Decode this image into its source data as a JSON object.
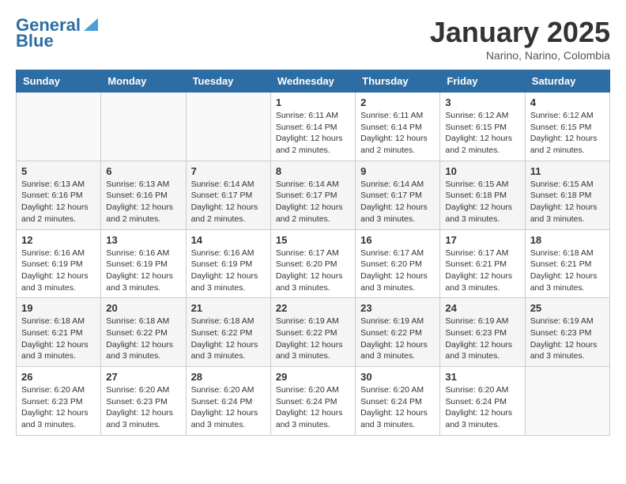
{
  "logo": {
    "line1": "General",
    "line2": "Blue"
  },
  "title": "January 2025",
  "subtitle": "Narino, Narino, Colombia",
  "headers": [
    "Sunday",
    "Monday",
    "Tuesday",
    "Wednesday",
    "Thursday",
    "Friday",
    "Saturday"
  ],
  "weeks": [
    [
      {
        "day": "",
        "info": ""
      },
      {
        "day": "",
        "info": ""
      },
      {
        "day": "",
        "info": ""
      },
      {
        "day": "1",
        "info": "Sunrise: 6:11 AM\nSunset: 6:14 PM\nDaylight: 12 hours and 2 minutes."
      },
      {
        "day": "2",
        "info": "Sunrise: 6:11 AM\nSunset: 6:14 PM\nDaylight: 12 hours and 2 minutes."
      },
      {
        "day": "3",
        "info": "Sunrise: 6:12 AM\nSunset: 6:15 PM\nDaylight: 12 hours and 2 minutes."
      },
      {
        "day": "4",
        "info": "Sunrise: 6:12 AM\nSunset: 6:15 PM\nDaylight: 12 hours and 2 minutes."
      }
    ],
    [
      {
        "day": "5",
        "info": "Sunrise: 6:13 AM\nSunset: 6:16 PM\nDaylight: 12 hours and 2 minutes."
      },
      {
        "day": "6",
        "info": "Sunrise: 6:13 AM\nSunset: 6:16 PM\nDaylight: 12 hours and 2 minutes."
      },
      {
        "day": "7",
        "info": "Sunrise: 6:14 AM\nSunset: 6:17 PM\nDaylight: 12 hours and 2 minutes."
      },
      {
        "day": "8",
        "info": "Sunrise: 6:14 AM\nSunset: 6:17 PM\nDaylight: 12 hours and 2 minutes."
      },
      {
        "day": "9",
        "info": "Sunrise: 6:14 AM\nSunset: 6:17 PM\nDaylight: 12 hours and 3 minutes."
      },
      {
        "day": "10",
        "info": "Sunrise: 6:15 AM\nSunset: 6:18 PM\nDaylight: 12 hours and 3 minutes."
      },
      {
        "day": "11",
        "info": "Sunrise: 6:15 AM\nSunset: 6:18 PM\nDaylight: 12 hours and 3 minutes."
      }
    ],
    [
      {
        "day": "12",
        "info": "Sunrise: 6:16 AM\nSunset: 6:19 PM\nDaylight: 12 hours and 3 minutes."
      },
      {
        "day": "13",
        "info": "Sunrise: 6:16 AM\nSunset: 6:19 PM\nDaylight: 12 hours and 3 minutes."
      },
      {
        "day": "14",
        "info": "Sunrise: 6:16 AM\nSunset: 6:19 PM\nDaylight: 12 hours and 3 minutes."
      },
      {
        "day": "15",
        "info": "Sunrise: 6:17 AM\nSunset: 6:20 PM\nDaylight: 12 hours and 3 minutes."
      },
      {
        "day": "16",
        "info": "Sunrise: 6:17 AM\nSunset: 6:20 PM\nDaylight: 12 hours and 3 minutes."
      },
      {
        "day": "17",
        "info": "Sunrise: 6:17 AM\nSunset: 6:21 PM\nDaylight: 12 hours and 3 minutes."
      },
      {
        "day": "18",
        "info": "Sunrise: 6:18 AM\nSunset: 6:21 PM\nDaylight: 12 hours and 3 minutes."
      }
    ],
    [
      {
        "day": "19",
        "info": "Sunrise: 6:18 AM\nSunset: 6:21 PM\nDaylight: 12 hours and 3 minutes."
      },
      {
        "day": "20",
        "info": "Sunrise: 6:18 AM\nSunset: 6:22 PM\nDaylight: 12 hours and 3 minutes."
      },
      {
        "day": "21",
        "info": "Sunrise: 6:18 AM\nSunset: 6:22 PM\nDaylight: 12 hours and 3 minutes."
      },
      {
        "day": "22",
        "info": "Sunrise: 6:19 AM\nSunset: 6:22 PM\nDaylight: 12 hours and 3 minutes."
      },
      {
        "day": "23",
        "info": "Sunrise: 6:19 AM\nSunset: 6:22 PM\nDaylight: 12 hours and 3 minutes."
      },
      {
        "day": "24",
        "info": "Sunrise: 6:19 AM\nSunset: 6:23 PM\nDaylight: 12 hours and 3 minutes."
      },
      {
        "day": "25",
        "info": "Sunrise: 6:19 AM\nSunset: 6:23 PM\nDaylight: 12 hours and 3 minutes."
      }
    ],
    [
      {
        "day": "26",
        "info": "Sunrise: 6:20 AM\nSunset: 6:23 PM\nDaylight: 12 hours and 3 minutes."
      },
      {
        "day": "27",
        "info": "Sunrise: 6:20 AM\nSunset: 6:23 PM\nDaylight: 12 hours and 3 minutes."
      },
      {
        "day": "28",
        "info": "Sunrise: 6:20 AM\nSunset: 6:24 PM\nDaylight: 12 hours and 3 minutes."
      },
      {
        "day": "29",
        "info": "Sunrise: 6:20 AM\nSunset: 6:24 PM\nDaylight: 12 hours and 3 minutes."
      },
      {
        "day": "30",
        "info": "Sunrise: 6:20 AM\nSunset: 6:24 PM\nDaylight: 12 hours and 3 minutes."
      },
      {
        "day": "31",
        "info": "Sunrise: 6:20 AM\nSunset: 6:24 PM\nDaylight: 12 hours and 3 minutes."
      },
      {
        "day": "",
        "info": ""
      }
    ]
  ]
}
